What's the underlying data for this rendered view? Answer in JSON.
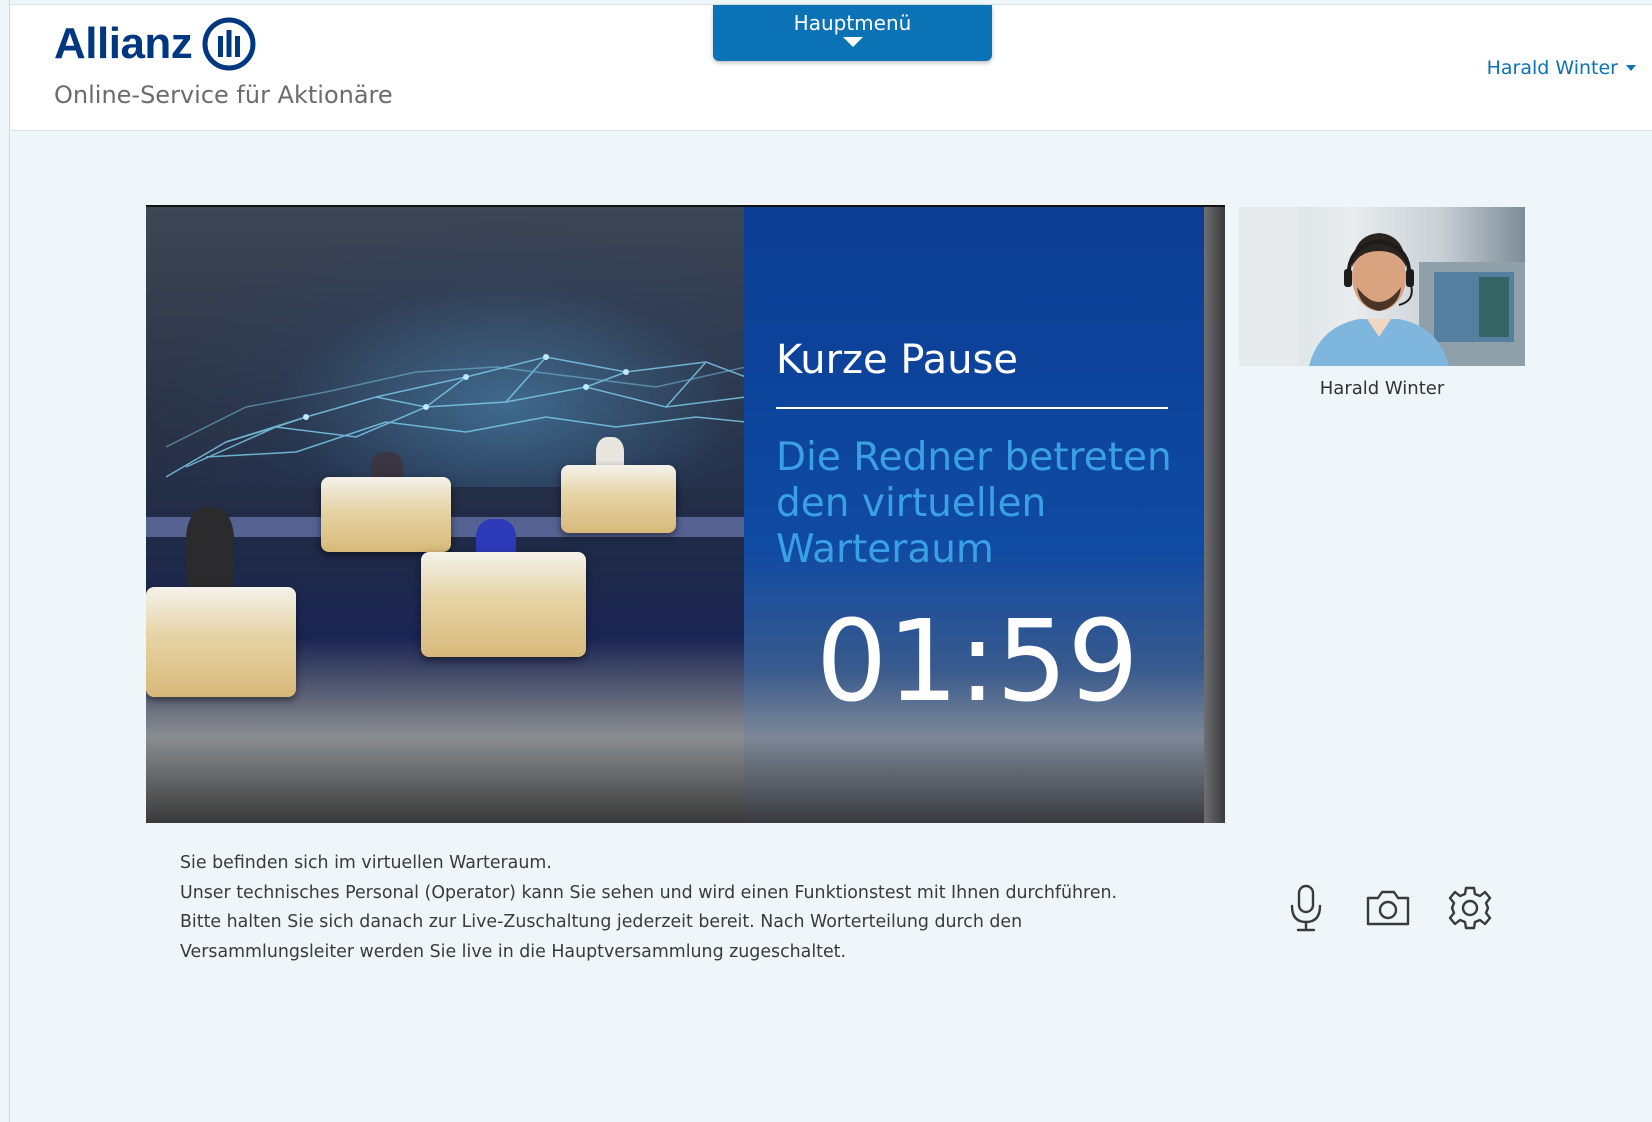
{
  "header": {
    "brand": "Allianz",
    "tagline": "Online-Service für Aktionäre",
    "menu_label": "Hauptmenü",
    "user_name": "Harald Winter"
  },
  "video": {
    "title": "Kurze Pause",
    "subtitle": "Die Redner betreten den virtuellen Warteraum",
    "countdown": "01:59"
  },
  "self_view": {
    "name": "Harald Winter"
  },
  "info": {
    "line1": "Sie befinden sich im virtuellen Warteraum.",
    "line2": "Unser technisches Personal (Operator) kann Sie sehen und wird einen Funktionstest mit Ihnen durchführen. Bitte halten Sie sich danach zur Live-Zuschaltung jederzeit bereit. Nach Worterteilung durch den Versammlungsleiter werden Sie live in die Hauptversammlung zugeschaltet."
  },
  "controls": {
    "microphone_icon": "microphone-icon",
    "camera_icon": "camera-icon",
    "settings_icon": "gear-icon"
  },
  "colors": {
    "brand_blue": "#003781",
    "accent_blue": "#0a72b5",
    "page_bg": "#eef6f9"
  }
}
